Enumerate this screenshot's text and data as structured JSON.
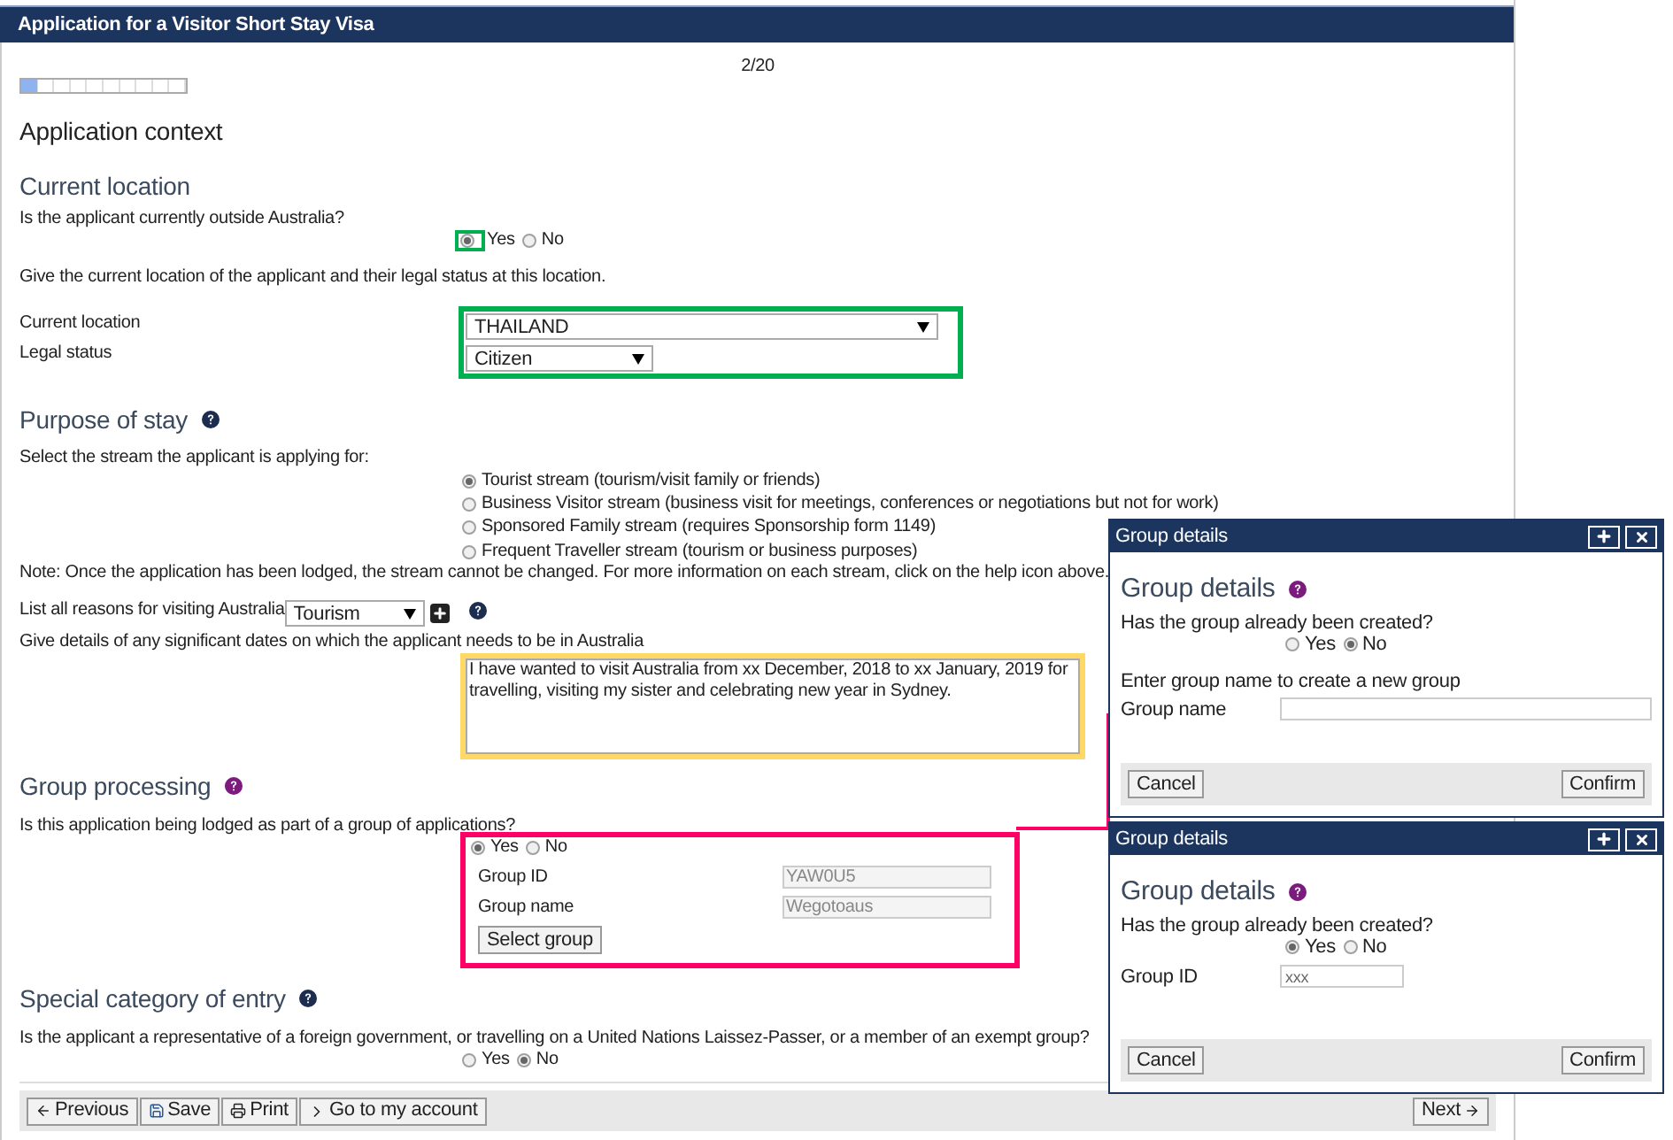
{
  "header": {
    "title": "Application for a Visitor Short Stay Visa"
  },
  "progress": {
    "page": "2/20",
    "level": 0.1
  },
  "heading": "Application context",
  "current_location": {
    "title": "Current location",
    "question": "Is the applicant currently outside Australia?",
    "options": [
      {
        "label": "Yes",
        "selected": true
      },
      {
        "label": "No",
        "selected": false
      }
    ],
    "instruction": "Give the current location of the applicant and their legal status at this location.",
    "fields": [
      {
        "label": "Current location",
        "value": "THAILAND"
      },
      {
        "label": "Legal status",
        "value": "Citizen"
      }
    ]
  },
  "purpose_of_stay": {
    "title": "Purpose of stay",
    "instruction": "Select the stream the applicant is applying for:",
    "streams": [
      {
        "label": "Tourist stream (tourism/visit family or friends)",
        "selected": true
      },
      {
        "label": "Business Visitor stream (business visit for meetings, conferences or negotiations but not for work)",
        "selected": false
      },
      {
        "label": "Sponsored Family stream (requires Sponsorship form 1149)",
        "selected": false
      },
      {
        "label": "Frequent Traveller stream (tourism or business purposes)",
        "selected": false
      }
    ],
    "note": "Note: Once the application has been lodged, the stream cannot be changed. For more information on each stream, click on the help icon above.",
    "reasons": {
      "label": "List all reasons for visiting Australia",
      "value": "Tourism"
    },
    "dates": {
      "label": "Give details of any significant dates on which the applicant needs to be in Australia",
      "value": "I have wanted to visit Australia from xx December, 2018 to xx January, 2019 for travelling, visiting my sister and celebrating new year in Sydney."
    }
  },
  "group_processing": {
    "title": "Group processing",
    "question": "Is this application being lodged as part of a group of applications?",
    "options": [
      {
        "label": "Yes",
        "selected": true
      },
      {
        "label": "No",
        "selected": false
      }
    ],
    "fields": [
      {
        "label": "Group ID",
        "value": "YAW0U5",
        "disabled": true
      },
      {
        "label": "Group name",
        "value": "Wegotoaus",
        "disabled": true
      }
    ],
    "button": "Select group"
  },
  "special_category": {
    "title": "Special category of entry",
    "question": "Is the applicant a representative of a foreign government, or travelling on a United Nations Laissez-Passer, or a member of an exempt group?",
    "options": [
      {
        "label": "Yes",
        "selected": false
      },
      {
        "label": "No",
        "selected": true
      }
    ]
  },
  "footer": {
    "buttons": [
      {
        "kind": "previous",
        "label": "Previous"
      },
      {
        "kind": "save",
        "label": "Save"
      },
      {
        "kind": "print",
        "label": "Print"
      },
      {
        "kind": "account",
        "label": "Go to my account"
      }
    ],
    "next": "Next"
  },
  "dialogs": [
    {
      "title": "Group details",
      "heading": "Group details",
      "question": "Has the group already been created?",
      "options": [
        {
          "label": "Yes",
          "selected": false
        },
        {
          "label": "No",
          "selected": true
        }
      ],
      "note": "Enter group name to create a new group",
      "field": {
        "label": "Group name"
      },
      "buttons": [
        "Cancel",
        "Confirm"
      ]
    },
    {
      "title": "Group details",
      "heading": "Group details",
      "question": "Has the group already been created?",
      "options": [
        {
          "label": "Yes",
          "selected": true
        },
        {
          "label": "No",
          "selected": false
        }
      ],
      "field": {
        "label": "Group ID",
        "value": "xxx"
      },
      "buttons": [
        "Cancel",
        "Confirm"
      ]
    }
  ]
}
